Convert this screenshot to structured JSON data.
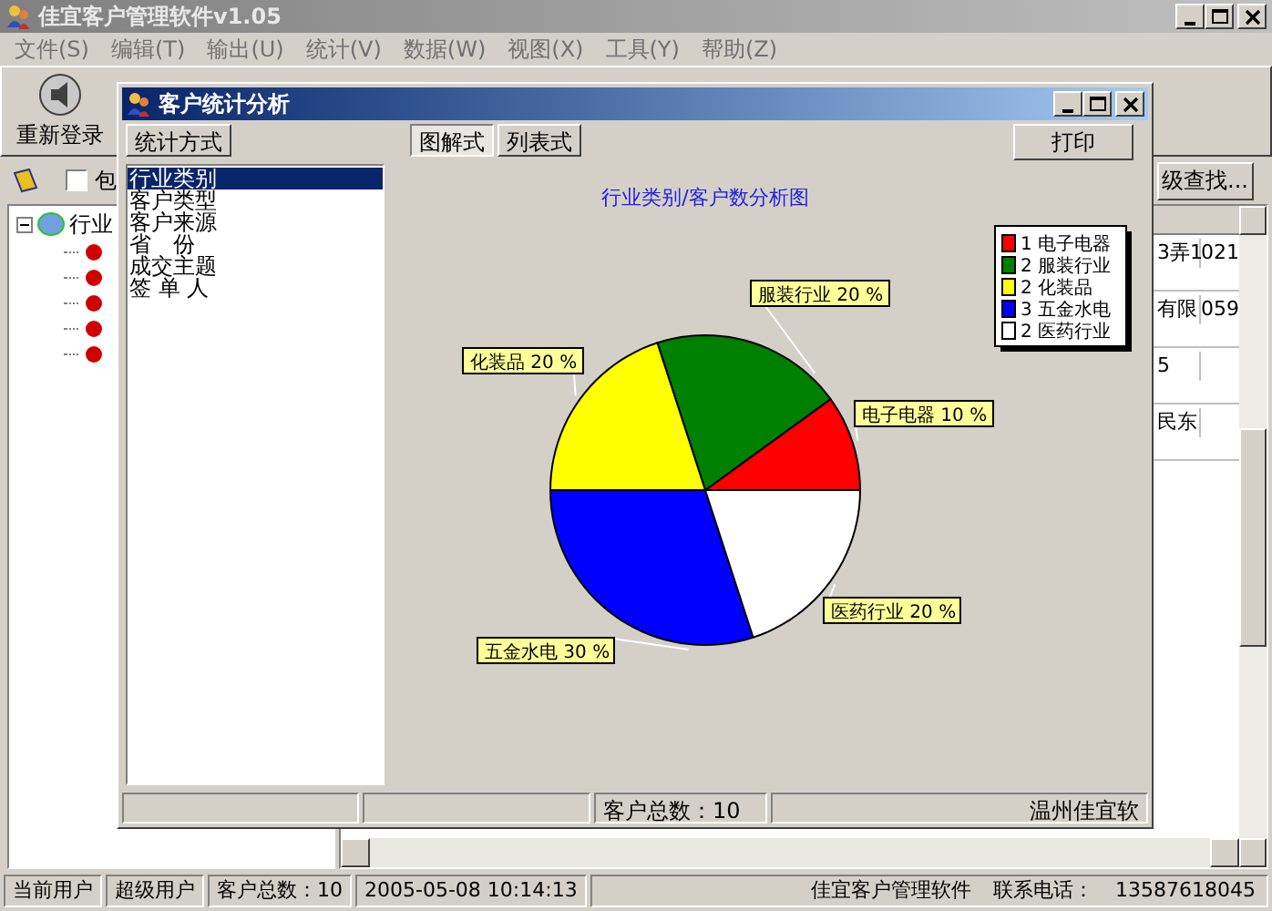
{
  "main_window": {
    "title": "佳宜客户管理软件v1.05",
    "menu": [
      "文件(S)",
      "编辑(T)",
      "输出(U)",
      "统计(V)",
      "数据(W)",
      "视图(X)",
      "工具(Y)",
      "帮助(Z)"
    ],
    "toolbar": [
      {
        "label": "重新登录"
      }
    ],
    "filter": {
      "checkbox": {
        "label": "包",
        "checked": false
      },
      "search_button": "级查找..."
    },
    "tree": {
      "label": "行业",
      "expanded": true,
      "children": [
        {
          "kind": "leaf"
        },
        {
          "kind": "leaf"
        },
        {
          "kind": "leaf"
        },
        {
          "kind": "leaf"
        },
        {
          "kind": "leaf"
        }
      ]
    },
    "table": {
      "rows": [
        {
          "column_1": "3弄1",
          "column_2": "021"
        },
        {
          "column_1": "有限",
          "column_2": "059"
        },
        {
          "column_1": "5"
        },
        {
          "column_1": "民东"
        }
      ]
    },
    "status_bar": [
      "当前用户",
      "超级用户",
      "客户总数：10",
      "2005-05-08 10:14:13",
      "佳宜客户管理软件",
      "联系电话：",
      "13587618045"
    ]
  },
  "dialog": {
    "title": "客户统计分析",
    "method_label": "统计方式",
    "methods": [
      {
        "label": "行业类别",
        "selected": true
      },
      {
        "label": "客户类型",
        "selected": false
      },
      {
        "label": "客户来源",
        "selected": false
      },
      {
        "label": "省　份",
        "selected": false
      },
      {
        "label": "成交主题",
        "selected": false
      },
      {
        "label": "签 单 人",
        "selected": false
      }
    ],
    "view_tabs": [
      {
        "label": "图解式",
        "selected": true
      },
      {
        "label": "列表式",
        "selected": false
      }
    ],
    "print_button": "打印",
    "chart": {
      "chart_data": {
        "type": "pie",
        "title": "行业类别/客户数分析图",
        "categories": [
          "电子电器",
          "服装行业",
          "化装品",
          "五金水电",
          "医药行业"
        ],
        "values": [
          10,
          20,
          20,
          30,
          20
        ],
        "legend": "right"
      },
      "slices": [
        {
          "color": "#ff0000",
          "count": "1",
          "label": "电子电器 10 %"
        },
        {
          "color": "#008000",
          "count": "2",
          "label": "服装行业 20 %"
        },
        {
          "color": "#ffff00",
          "count": "2",
          "label": "化装品 20 %"
        },
        {
          "color": "#0000ff",
          "count": "3",
          "label": "五金水电 30 %"
        },
        {
          "color": "#ffffff",
          "count": "2",
          "label": "医药行业 20 %"
        }
      ]
    },
    "status_bar": [
      "客户总数：10",
      "温州佳宜软"
    ]
  }
}
